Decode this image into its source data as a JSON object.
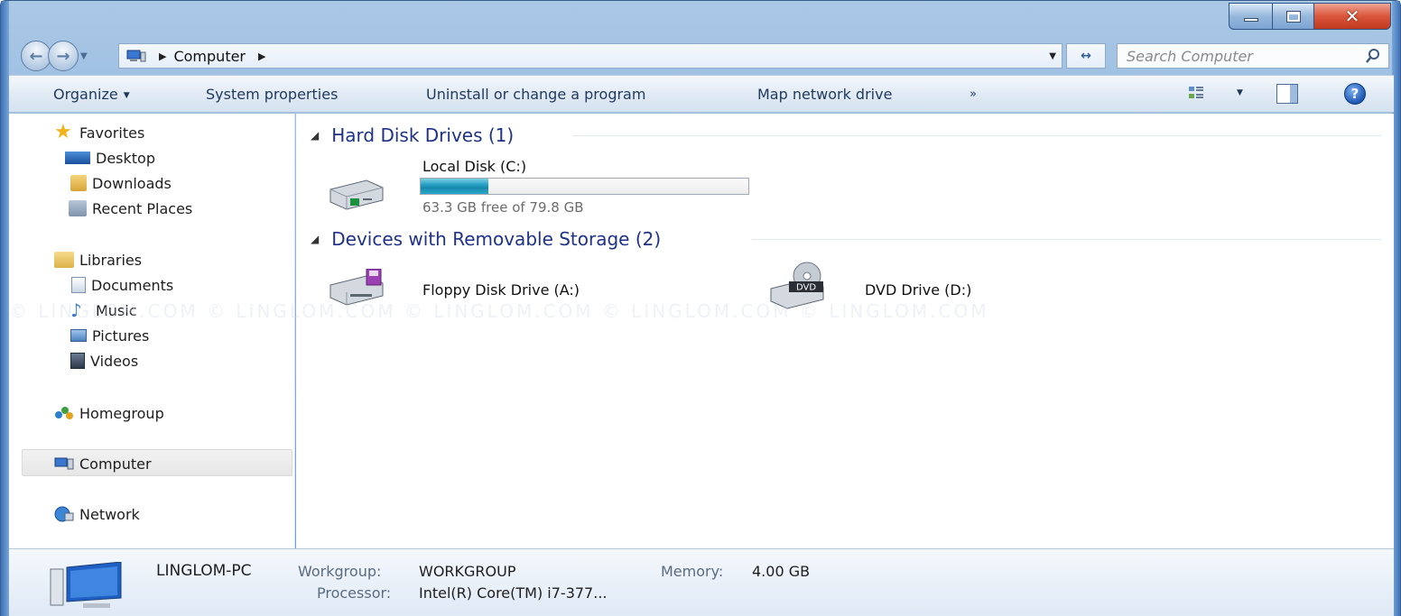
{
  "window": {
    "caption_buttons": {
      "minimize": "minimize",
      "maximize": "maximize",
      "close": "close"
    }
  },
  "address": {
    "location": "Computer",
    "search_placeholder": "Search Computer"
  },
  "commands": {
    "organize": "Organize",
    "system_properties": "System properties",
    "uninstall": "Uninstall or change a program",
    "map_drive": "Map network drive",
    "overflow": "»"
  },
  "sidebar": {
    "favorites": {
      "label": "Favorites",
      "items": [
        "Desktop",
        "Downloads",
        "Recent Places"
      ]
    },
    "libraries": {
      "label": "Libraries",
      "items": [
        "Documents",
        "Music",
        "Pictures",
        "Videos"
      ]
    },
    "homegroup": "Homegroup",
    "computer": "Computer",
    "network": "Network"
  },
  "groups": {
    "hard_disks": {
      "title": "Hard Disk Drives (1)",
      "drives": [
        {
          "name": "Local Disk (C:)",
          "free_text": "63.3 GB free of 79.8 GB",
          "used_fraction": 0.207
        }
      ]
    },
    "removable": {
      "title": "Devices with Removable Storage (2)",
      "drives": [
        {
          "name": "Floppy Disk Drive (A:)"
        },
        {
          "name": "DVD Drive (D:)",
          "badge": "DVD"
        }
      ]
    }
  },
  "details": {
    "pc_name": "LINGLOM-PC",
    "workgroup_label": "Workgroup:",
    "workgroup_value": "WORKGROUP",
    "memory_label": "Memory:",
    "memory_value": "4.00 GB",
    "processor_label": "Processor:",
    "processor_value": "Intel(R) Core(TM) i7-377..."
  },
  "watermark": "© LINGLOM.COM     © LINGLOM.COM     © LINGLOM.COM     © LINGLOM.COM     © LINGLOM.COM",
  "colors": {
    "accent_header": "#1e3287",
    "capacity_fill": "#26a0c4",
    "frame": "#6b9bd0"
  }
}
